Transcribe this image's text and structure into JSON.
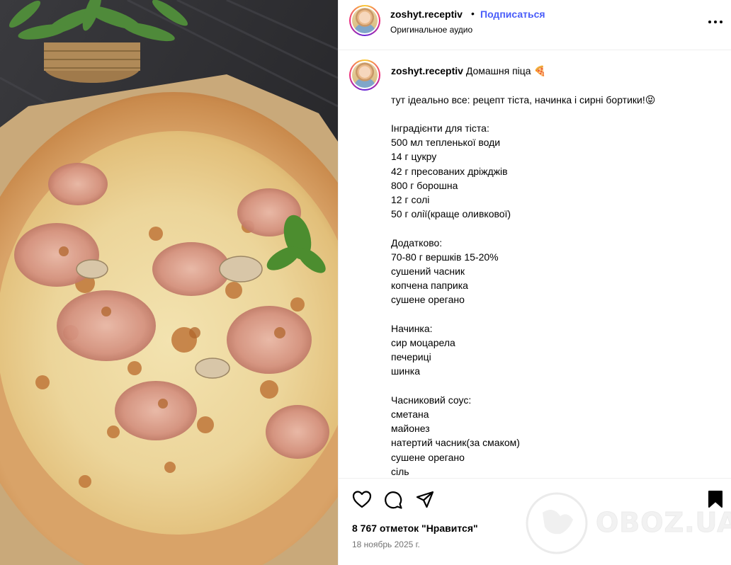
{
  "post": {
    "username": "zoshyt.receptiv",
    "separator": "•",
    "follow_label": "Подписаться",
    "audio_label": "Оригинальное аудио",
    "more_icon": "more-horizontal-icon"
  },
  "caption": {
    "title": "Домашня піца",
    "title_emoji": "🍕",
    "lines": [
      "тут ідеально все: рецепт тіста, начинка і сирні бортики!😝",
      "",
      "Інградієнти для тіста:",
      "500 мл тепленької води",
      "14 г цукру",
      "42 г пресованих дріжджів",
      "800 г борошна",
      "12 г солі",
      "50 г олії(краще оливкової)",
      "",
      "Додатково:",
      "70-80 г вершків 15-20%",
      "сушений часник",
      "копчена паприка",
      "сушене орегано",
      "",
      "Начинка:",
      "сир моцарела",
      "печериці",
      "шинка",
      "",
      "Часниковий соус:",
      "сметана",
      "майонез",
      "натертий часник(за смаком)",
      "сушене орегано",
      "сіль"
    ]
  },
  "actions": {
    "like_icon": "heart-icon",
    "comment_icon": "comment-icon",
    "share_icon": "share-icon",
    "save_icon": "bookmark-icon"
  },
  "stats": {
    "likes": "8 767 отметок \"Нравится\"",
    "date": "18 ноябрь 2025 г."
  },
  "watermark": {
    "text": "OBOZ.UA"
  },
  "colors": {
    "follow": "#4a5df9",
    "muted": "#737373",
    "divider": "#efefef"
  }
}
